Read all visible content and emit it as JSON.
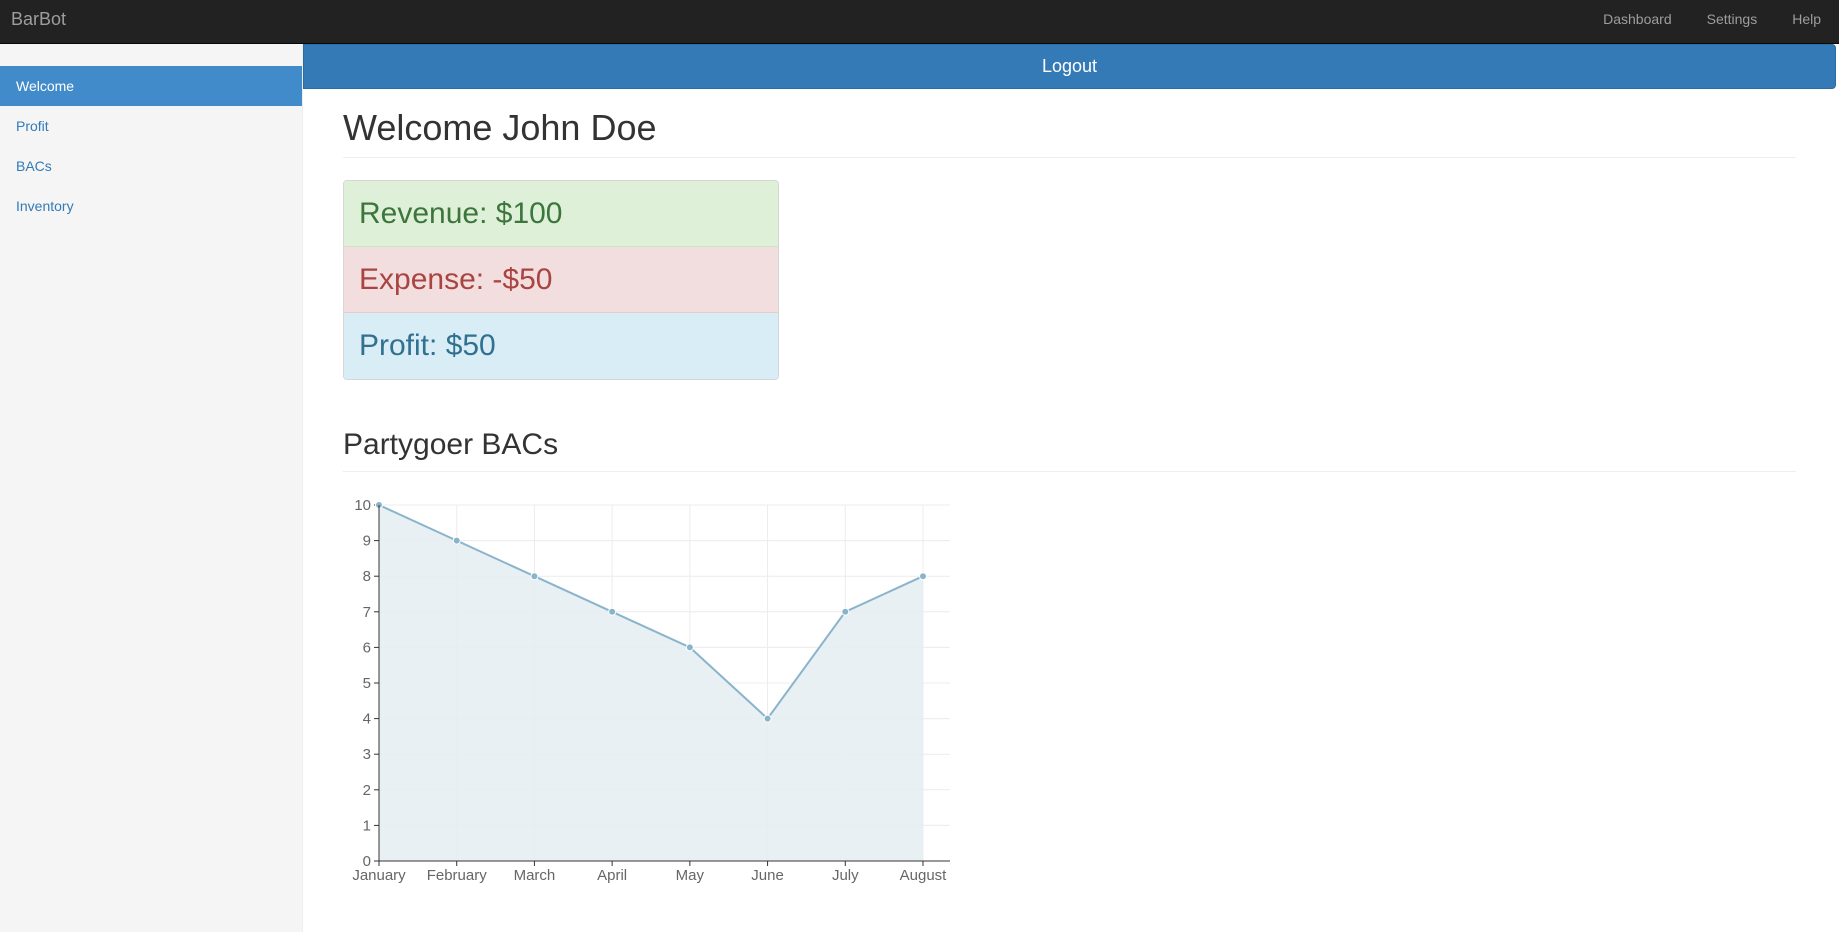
{
  "navbar": {
    "brand": "BarBot",
    "links": [
      "Dashboard",
      "Settings",
      "Help"
    ]
  },
  "sidebar": {
    "items": [
      {
        "label": "Welcome",
        "active": true
      },
      {
        "label": "Profit",
        "active": false
      },
      {
        "label": "BACs",
        "active": false
      },
      {
        "label": "Inventory",
        "active": false
      }
    ]
  },
  "logout_label": "Logout",
  "main": {
    "title": "Welcome John Doe",
    "summary": {
      "revenue": "Revenue: $100",
      "expense": "Expense: -$50",
      "profit": "Profit: $50"
    },
    "section_title": "Partygoer BACs"
  },
  "colors": {
    "navbar_bg": "#222222",
    "primary": "#337ab7",
    "sidebar_active": "#428bca",
    "success_bg": "#dff0d8",
    "danger_bg": "#f2dede",
    "info_bg": "#d9edf7",
    "series_line": "#8ab4cc",
    "series_fill": "#e6eef2"
  },
  "chart_data": {
    "type": "area",
    "categories": [
      "January",
      "February",
      "March",
      "April",
      "May",
      "June",
      "July",
      "August"
    ],
    "series": [
      {
        "values": [
          10,
          9,
          8,
          7,
          6,
          4,
          7,
          8
        ]
      }
    ],
    "ylim": [
      0,
      10
    ],
    "yticks": [
      0,
      1,
      2,
      3,
      4,
      5,
      6,
      7,
      8,
      9,
      10
    ],
    "grid": true,
    "legend": "none"
  }
}
